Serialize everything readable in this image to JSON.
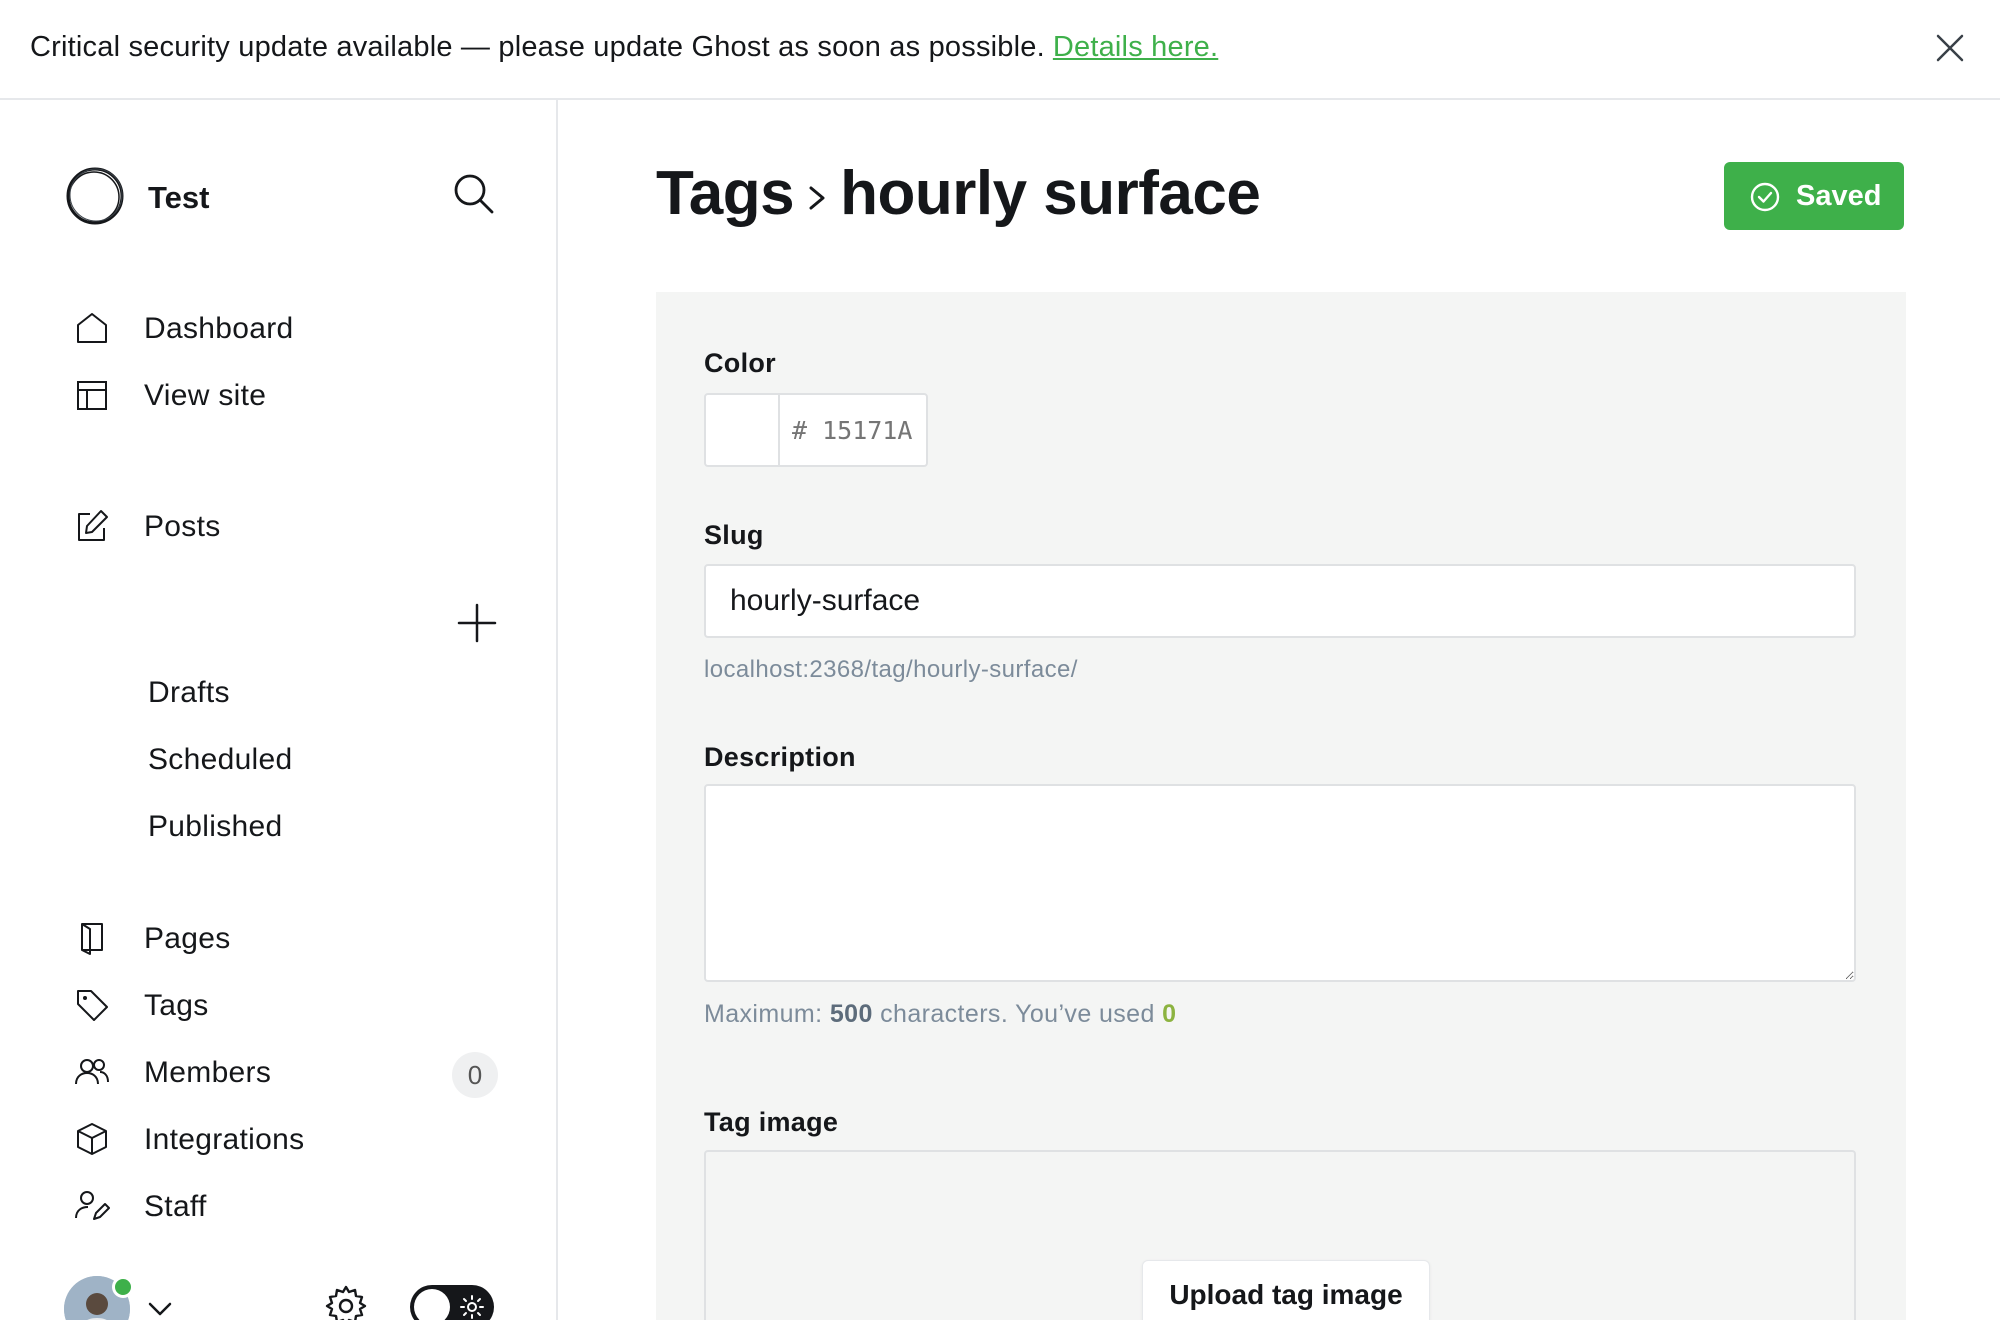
{
  "banner": {
    "message": "Critical security update available — please update Ghost as soon as possible.",
    "link_label": "Details here."
  },
  "sidebar": {
    "site_name": "Test",
    "nav": [
      {
        "label": "Dashboard",
        "icon": "home-icon"
      },
      {
        "label": "View site",
        "icon": "layout-icon"
      }
    ],
    "posts": {
      "label": "Posts",
      "icon": "edit-icon",
      "sub_items": [
        "Drafts",
        "Scheduled",
        "Published"
      ]
    },
    "nav2": [
      {
        "label": "Pages",
        "icon": "page-icon"
      },
      {
        "label": "Tags",
        "icon": "tag-icon"
      },
      {
        "label": "Members",
        "icon": "members-icon",
        "count": "0"
      },
      {
        "label": "Integrations",
        "icon": "box-icon"
      },
      {
        "label": "Staff",
        "icon": "staff-icon"
      }
    ]
  },
  "main": {
    "breadcrumb_parent": "Tags",
    "title": "hourly surface",
    "save_label": "Saved",
    "form": {
      "color_label": "Color",
      "color_value": "# 15171A",
      "slug_label": "Slug",
      "slug_value": "hourly-surface",
      "slug_hint": "localhost:2368/tag/hourly-surface/",
      "description_label": "Description",
      "description_value": "",
      "hint_prefix": "Maximum:",
      "hint_max": "500",
      "hint_middle": "characters. You’ve used",
      "hint_used": "0",
      "tag_image_label": "Tag image",
      "upload_label": "Upload tag image"
    }
  },
  "colors": {
    "accent_green": "#3eb04a",
    "text_dark": "#15171a",
    "hint_gray": "#7c8b9a",
    "used_count_green": "#8cb340"
  }
}
